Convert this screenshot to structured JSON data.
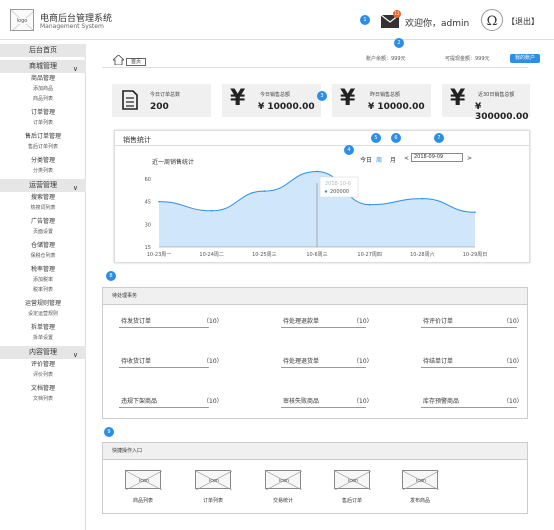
{
  "header": {
    "logo_text": "logo",
    "title": "电商后台管理系统",
    "subtitle": "Management System",
    "badge_count": "12",
    "welcome": "欢迎你，admin",
    "logout": "【退出】"
  },
  "sidebar": {
    "items": [
      {
        "label": "后台首页",
        "type": "head"
      },
      {
        "label": "商城管理",
        "type": "head",
        "chevron": "∨"
      },
      {
        "label": "商品管理",
        "type": "item"
      },
      {
        "label": "添加商品",
        "type": "sub"
      },
      {
        "label": "商品列表",
        "type": "sub"
      },
      {
        "label": "订单管理",
        "type": "item"
      },
      {
        "label": "订单列表",
        "type": "sub"
      },
      {
        "label": "售后订单管理",
        "type": "item"
      },
      {
        "label": "售后订单列表",
        "type": "sub"
      },
      {
        "label": "分类管理",
        "type": "item"
      },
      {
        "label": "分类列表",
        "type": "sub"
      },
      {
        "label": "运营管理",
        "type": "head",
        "chevron": "∨"
      },
      {
        "label": "搜索管理",
        "type": "item"
      },
      {
        "label": "热搜词列表",
        "type": "sub"
      },
      {
        "label": "广告管理",
        "type": "item"
      },
      {
        "label": "页面设置",
        "type": "sub"
      },
      {
        "label": "仓储管理",
        "type": "item"
      },
      {
        "label": "保税仓列表",
        "type": "sub"
      },
      {
        "label": "税率管理",
        "type": "item"
      },
      {
        "label": "添加税率",
        "type": "sub"
      },
      {
        "label": "税率列表",
        "type": "sub"
      },
      {
        "label": "运营规则管理",
        "type": "item"
      },
      {
        "label": "设定运营规则",
        "type": "sub"
      },
      {
        "label": "拆单管理",
        "type": "item"
      },
      {
        "label": "拆单设置",
        "type": "sub"
      },
      {
        "label": "内容管理",
        "type": "head",
        "chevron": "∨"
      },
      {
        "label": "评价管理",
        "type": "item"
      },
      {
        "label": "评价列表",
        "type": "sub"
      },
      {
        "label": "文档管理",
        "type": "item"
      },
      {
        "label": "文档列表",
        "type": "sub"
      }
    ]
  },
  "topbar": {
    "home_tab": "首页",
    "account_balance": "账户余额：999元",
    "withdraw_balance": "可提现金额：999元",
    "my_account_btn": "我的账户"
  },
  "stats": [
    {
      "label": "今日订单总数",
      "value": "200",
      "icon": "document-icon"
    },
    {
      "label": "今日销售总额",
      "value": "¥ 10000.00",
      "icon": "yen-icon"
    },
    {
      "label": "昨日销售总额",
      "value": "¥ 10000.00",
      "icon": "yen-icon"
    },
    {
      "label": "近30日销售总额",
      "value": "¥ 300000.00",
      "icon": "yen-icon"
    }
  ],
  "chart_panel": {
    "title": "销售统计",
    "subtitle": "近一周销售统计",
    "today": "今日",
    "week": "周",
    "month": "月",
    "date_value": "2018-09-09",
    "prev": "<",
    "next": ">"
  },
  "chart_data": {
    "type": "area",
    "x": [
      "10-23周一",
      "10-24周二",
      "10-25周三",
      "10-6周三",
      "10-27周四",
      "10-28周六",
      "10-29周日"
    ],
    "values": [
      45,
      39,
      52,
      65,
      43,
      47,
      38
    ],
    "yticks": [
      15,
      30,
      45,
      60
    ],
    "tooltip_date": "2018-10-6",
    "tooltip_value": "200000",
    "color": "#2b8fe8"
  },
  "todo": {
    "title": "待处理事务",
    "items": [
      {
        "label": "待发货订单",
        "count": "（10）"
      },
      {
        "label": "待处理退款单",
        "count": "（10）"
      },
      {
        "label": "待评价订单",
        "count": "（10）"
      },
      {
        "label": "待收货订单",
        "count": "（10）"
      },
      {
        "label": "待处理退货单",
        "count": "（10）"
      },
      {
        "label": "待结单订单",
        "count": "（10）"
      },
      {
        "label": "违规下架商品",
        "count": "（10）"
      },
      {
        "label": "审核失败商品",
        "count": "（10）"
      },
      {
        "label": "库存预警商品",
        "count": "（10）"
      }
    ]
  },
  "quick": {
    "title": "快捷操作入口",
    "items": [
      {
        "label": "商品列表"
      },
      {
        "label": "订单列表"
      },
      {
        "label": "交易统计"
      },
      {
        "label": "售后订单"
      },
      {
        "label": "发布商品"
      }
    ],
    "icon_text": "icon"
  },
  "pins": [
    "1",
    "2",
    "3",
    "4",
    "5",
    "6",
    "7",
    "8",
    "9"
  ]
}
